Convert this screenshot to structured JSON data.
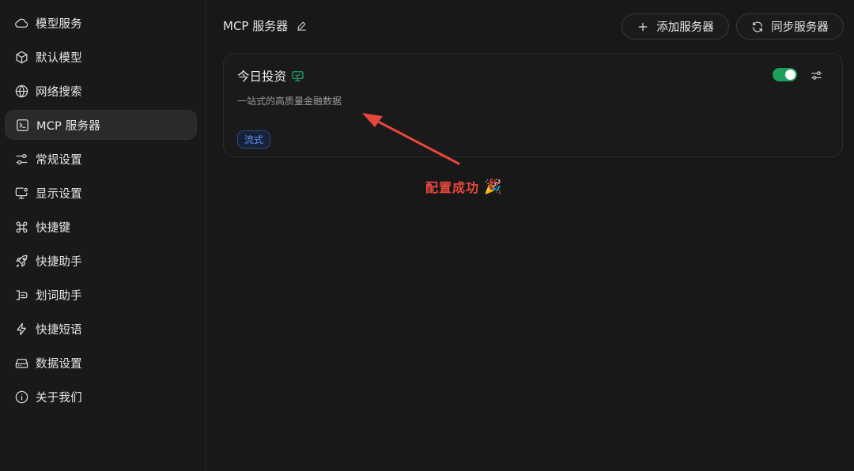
{
  "sidebar": {
    "items": [
      {
        "label": "模型服务",
        "icon": "cloud-icon"
      },
      {
        "label": "默认模型",
        "icon": "cube-icon"
      },
      {
        "label": "网络搜索",
        "icon": "globe-icon"
      },
      {
        "label": "MCP 服务器",
        "icon": "terminal-icon",
        "active": true
      },
      {
        "label": "常规设置",
        "icon": "sliders-icon"
      },
      {
        "label": "显示设置",
        "icon": "monitor-settings-icon"
      },
      {
        "label": "快捷键",
        "icon": "command-icon"
      },
      {
        "label": "快捷助手",
        "icon": "rocket-icon"
      },
      {
        "label": "划词助手",
        "icon": "text-select-icon"
      },
      {
        "label": "快捷短语",
        "icon": "lightning-icon"
      },
      {
        "label": "数据设置",
        "icon": "hard-drive-icon"
      },
      {
        "label": "关于我们",
        "icon": "info-icon"
      }
    ]
  },
  "main": {
    "title": "MCP 服务器",
    "add_button": "添加服务器",
    "sync_button": "同步服务器",
    "server": {
      "name": "今日投资",
      "description": "一站式的高质量金融数据",
      "tag": "流式",
      "enabled": true
    }
  },
  "annotation": {
    "text": "配置成功",
    "emoji": "🎉",
    "color": "#e8473f"
  },
  "colors": {
    "accent_green": "#1fa05a",
    "tag_blue": "#5b8ff0",
    "background": "#181818"
  }
}
